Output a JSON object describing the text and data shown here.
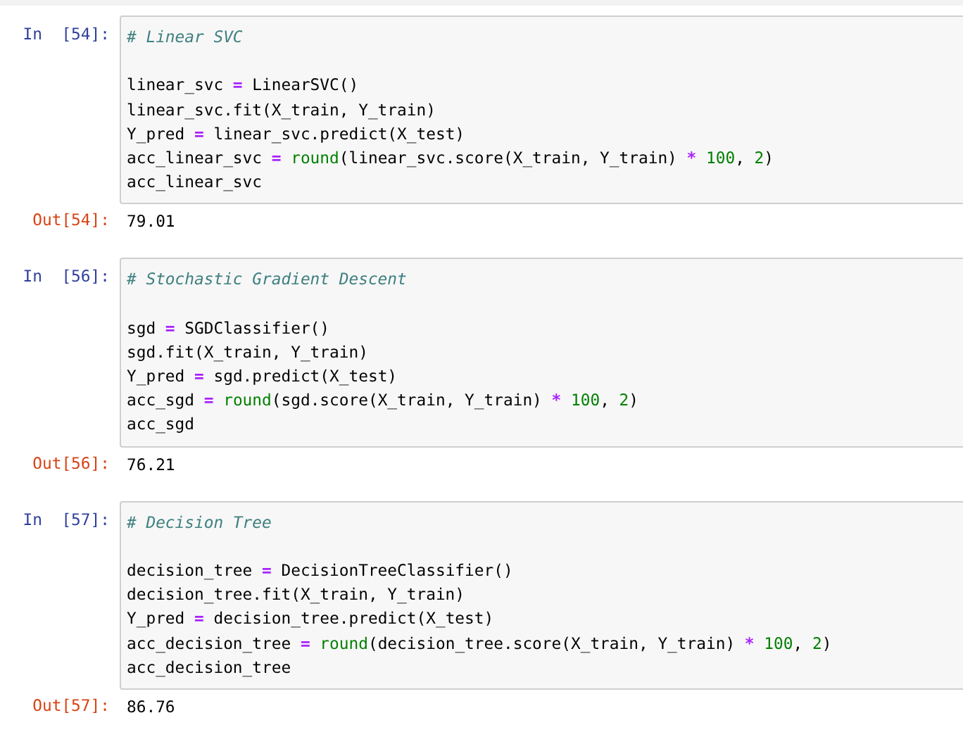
{
  "cells": [
    {
      "in_prompt": "In  [54]:",
      "out_prompt": "Out[54]:",
      "output": "79.01",
      "lines": [
        {
          "kind": "code",
          "tokens": [
            {
              "kind": "comment",
              "text": "# Linear SVC"
            }
          ]
        },
        {
          "kind": "blank"
        },
        {
          "kind": "code",
          "tokens": [
            {
              "kind": "plain",
              "text": "linear_svc"
            },
            {
              "kind": "op",
              "text": " = "
            },
            {
              "kind": "plain",
              "text": "LinearSVC()"
            }
          ]
        },
        {
          "kind": "code",
          "tokens": [
            {
              "kind": "plain",
              "text": "linear_svc.fit(X_train, Y_train)"
            }
          ]
        },
        {
          "kind": "code",
          "tokens": [
            {
              "kind": "plain",
              "text": "Y_pred"
            },
            {
              "kind": "op",
              "text": " = "
            },
            {
              "kind": "plain",
              "text": "linear_svc.predict(X_test)"
            }
          ]
        },
        {
          "kind": "code",
          "tokens": [
            {
              "kind": "plain",
              "text": "acc_linear_svc"
            },
            {
              "kind": "op",
              "text": " = "
            },
            {
              "kind": "builtin",
              "text": "round"
            },
            {
              "kind": "plain",
              "text": "(linear_svc.score(X_train, Y_train)"
            },
            {
              "kind": "op",
              "text": " * "
            },
            {
              "kind": "num",
              "text": "100"
            },
            {
              "kind": "plain",
              "text": ", "
            },
            {
              "kind": "num",
              "text": "2"
            },
            {
              "kind": "plain",
              "text": ")"
            }
          ]
        },
        {
          "kind": "code",
          "tokens": [
            {
              "kind": "plain",
              "text": "acc_linear_svc"
            }
          ]
        }
      ]
    },
    {
      "in_prompt": "In  [56]:",
      "out_prompt": "Out[56]:",
      "output": "76.21",
      "lines": [
        {
          "kind": "code",
          "tokens": [
            {
              "kind": "comment",
              "text": "# Stochastic Gradient Descent"
            }
          ]
        },
        {
          "kind": "blank"
        },
        {
          "kind": "code",
          "tokens": [
            {
              "kind": "plain",
              "text": "sgd"
            },
            {
              "kind": "op",
              "text": " = "
            },
            {
              "kind": "plain",
              "text": "SGDClassifier()"
            }
          ]
        },
        {
          "kind": "code",
          "tokens": [
            {
              "kind": "plain",
              "text": "sgd.fit(X_train, Y_train)"
            }
          ]
        },
        {
          "kind": "code",
          "tokens": [
            {
              "kind": "plain",
              "text": "Y_pred"
            },
            {
              "kind": "op",
              "text": " = "
            },
            {
              "kind": "plain",
              "text": "sgd.predict(X_test)"
            }
          ]
        },
        {
          "kind": "code",
          "tokens": [
            {
              "kind": "plain",
              "text": "acc_sgd"
            },
            {
              "kind": "op",
              "text": " = "
            },
            {
              "kind": "builtin",
              "text": "round"
            },
            {
              "kind": "plain",
              "text": "(sgd.score(X_train, Y_train)"
            },
            {
              "kind": "op",
              "text": " * "
            },
            {
              "kind": "num",
              "text": "100"
            },
            {
              "kind": "plain",
              "text": ", "
            },
            {
              "kind": "num",
              "text": "2"
            },
            {
              "kind": "plain",
              "text": ")"
            }
          ]
        },
        {
          "kind": "code",
          "tokens": [
            {
              "kind": "plain",
              "text": "acc_sgd"
            }
          ]
        }
      ]
    },
    {
      "in_prompt": "In  [57]:",
      "out_prompt": "Out[57]:",
      "output": "86.76",
      "lines": [
        {
          "kind": "code",
          "tokens": [
            {
              "kind": "comment",
              "text": "# Decision Tree"
            }
          ]
        },
        {
          "kind": "blank"
        },
        {
          "kind": "code",
          "tokens": [
            {
              "kind": "plain",
              "text": "decision_tree"
            },
            {
              "kind": "op",
              "text": " = "
            },
            {
              "kind": "plain",
              "text": "DecisionTreeClassifier()"
            }
          ]
        },
        {
          "kind": "code",
          "tokens": [
            {
              "kind": "plain",
              "text": "decision_tree.fit(X_train, Y_train)"
            }
          ]
        },
        {
          "kind": "code",
          "tokens": [
            {
              "kind": "plain",
              "text": "Y_pred"
            },
            {
              "kind": "op",
              "text": " = "
            },
            {
              "kind": "plain",
              "text": "decision_tree.predict(X_test)"
            }
          ]
        },
        {
          "kind": "code",
          "tokens": [
            {
              "kind": "plain",
              "text": "acc_decision_tree"
            },
            {
              "kind": "op",
              "text": " = "
            },
            {
              "kind": "builtin",
              "text": "round"
            },
            {
              "kind": "plain",
              "text": "(decision_tree.score(X_train, Y_train)"
            },
            {
              "kind": "op",
              "text": " * "
            },
            {
              "kind": "num",
              "text": "100"
            },
            {
              "kind": "plain",
              "text": ", "
            },
            {
              "kind": "num",
              "text": "2"
            },
            {
              "kind": "plain",
              "text": ")"
            }
          ]
        },
        {
          "kind": "code",
          "tokens": [
            {
              "kind": "plain",
              "text": "acc_decision_tree"
            }
          ]
        }
      ]
    }
  ]
}
